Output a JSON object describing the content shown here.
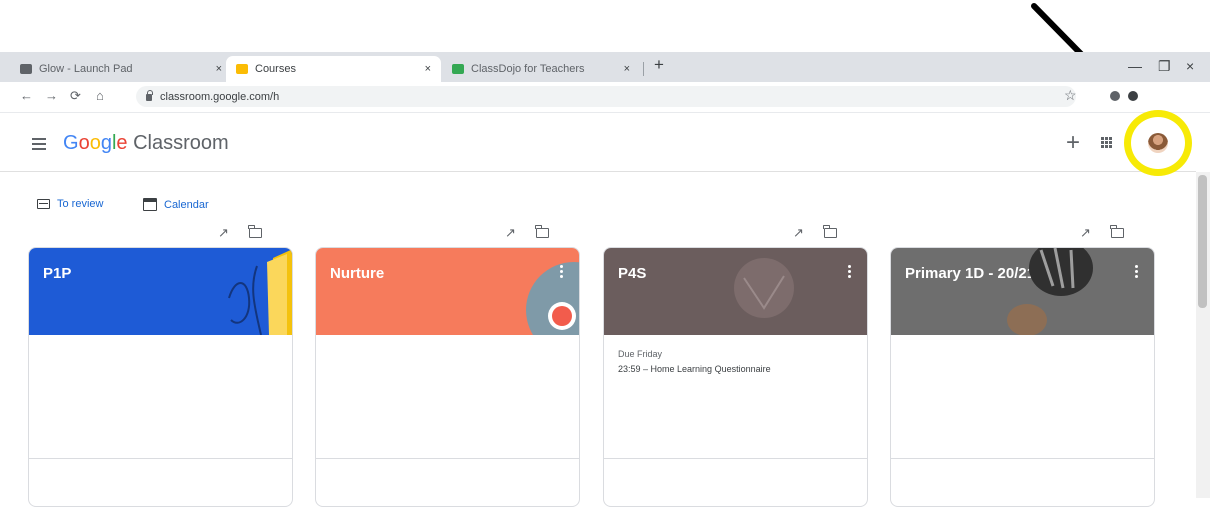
{
  "browser": {
    "tabs": [
      {
        "title": "Glow - Launch Pad",
        "close": "×",
        "favicon_color": "#5f6368"
      },
      {
        "title": "Courses",
        "close": "×",
        "favicon_color": "#fbbc05"
      },
      {
        "title": "ClassDojo for Teachers",
        "close": "×",
        "favicon_color": "#34a853"
      }
    ],
    "new_tab": "+",
    "controls": {
      "minimize": "—",
      "maximize": "❐",
      "close": "×"
    },
    "nav": {
      "back": "←",
      "forward": "→",
      "reload": "⟳",
      "home": "⌂"
    },
    "url": "classroom.google.com/h",
    "bookmark": "☆"
  },
  "app": {
    "brand_google": [
      "G",
      "o",
      "o",
      "g",
      "l",
      "e"
    ],
    "brand_product": "Classroom",
    "add_button": "+"
  },
  "subnav": {
    "to_review": "To review",
    "calendar": "Calendar"
  },
  "courses": [
    {
      "name": "P1P",
      "banner_color": "#1e5bd6"
    },
    {
      "name": "Nurture",
      "banner_color": "#f67b5c"
    },
    {
      "name": "P4S",
      "banner_color": "#6b5d5d",
      "due_label": "Due Friday",
      "due_item": "23:59 – Home Learning Questionnaire"
    },
    {
      "name": "Primary 1D - 20/21",
      "banner_color": "#6e6e6e"
    }
  ],
  "colors": {
    "highlight": "#f7ea06",
    "accent": "#1967d2"
  }
}
